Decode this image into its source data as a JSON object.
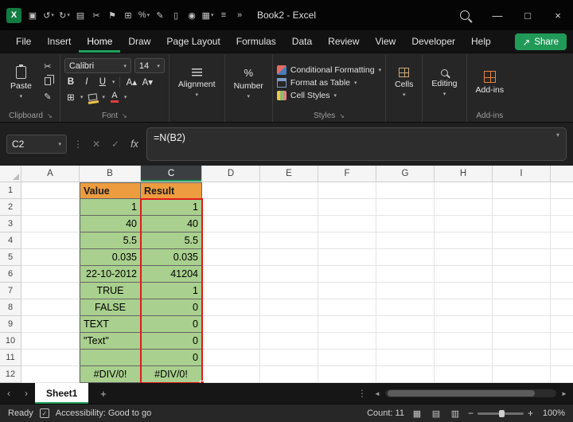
{
  "title_bar": {
    "title": "Book2 - Excel",
    "qat": [
      {
        "name": "save-icon",
        "glyph": "▣"
      },
      {
        "name": "undo-icon",
        "glyph": "↺",
        "chev": true
      },
      {
        "name": "redo-icon",
        "glyph": "↻",
        "chev": true
      },
      {
        "name": "copy-icon",
        "glyph": "▤"
      },
      {
        "name": "cut-icon",
        "glyph": "✂"
      },
      {
        "name": "flag-icon",
        "glyph": "⚑"
      },
      {
        "name": "borders-icon",
        "glyph": "⊞"
      },
      {
        "name": "percent-style-icon",
        "glyph": "%",
        "chev": true
      },
      {
        "name": "format-painter-icon",
        "glyph": "✎"
      },
      {
        "name": "new-document-icon",
        "glyph": "▯"
      },
      {
        "name": "camera-icon",
        "glyph": "◉"
      },
      {
        "name": "table-icon",
        "glyph": "▦",
        "chev": true
      },
      {
        "name": "sort-icon",
        "glyph": "≡"
      },
      {
        "name": "more-commands-icon",
        "glyph": "»"
      }
    ]
  },
  "menu": {
    "tabs": [
      "File",
      "Insert",
      "Home",
      "Draw",
      "Page Layout",
      "Formulas",
      "Data",
      "Review",
      "View",
      "Developer",
      "Help"
    ],
    "active_tab": "Home",
    "share_label": "Share"
  },
  "ribbon": {
    "paste_label": "Paste",
    "clipboard_group": "Clipboard",
    "font_name": "Calibri",
    "font_size": "14",
    "bold": "B",
    "italic": "I",
    "underline": "U",
    "font_group": "Font",
    "alignment_label": "Alignment",
    "number_label": "Number",
    "conditional_formatting": "Conditional Formatting",
    "format_as_table": "Format as Table",
    "cell_styles": "Cell Styles",
    "styles_group": "Styles",
    "cells_label": "Cells",
    "editing_label": "Editing",
    "addins_label": "Add-ins",
    "addins_group": "Add-ins"
  },
  "formula_bar": {
    "name_box_value": "C2",
    "fx_label": "fx",
    "formula": "=N(B2)"
  },
  "grid": {
    "column_headers": [
      "A",
      "B",
      "C",
      "D",
      "E",
      "F",
      "G",
      "H",
      "I"
    ],
    "selected_column": "C",
    "highlighted_range": "C2:C12",
    "rows": [
      {
        "n": "1",
        "b": "Value",
        "c": "Result",
        "type": "header",
        "b_align": "l",
        "c_align": "l"
      },
      {
        "n": "2",
        "b": "1",
        "c": "1",
        "b_align": "r",
        "c_align": "r"
      },
      {
        "n": "3",
        "b": "40",
        "c": "40",
        "b_align": "r",
        "c_align": "r"
      },
      {
        "n": "4",
        "b": "5.5",
        "c": "5.5",
        "b_align": "r",
        "c_align": "r"
      },
      {
        "n": "5",
        "b": "0.035",
        "c": "0.035",
        "b_align": "r",
        "c_align": "r"
      },
      {
        "n": "6",
        "b": "22-10-2012",
        "c": "41204",
        "b_align": "r",
        "c_align": "r"
      },
      {
        "n": "7",
        "b": "TRUE",
        "c": "1",
        "b_align": "c",
        "c_align": "r"
      },
      {
        "n": "8",
        "b": "FALSE",
        "c": "0",
        "b_align": "c",
        "c_align": "r"
      },
      {
        "n": "9",
        "b": "TEXT",
        "c": "0",
        "b_align": "l",
        "c_align": "r"
      },
      {
        "n": "10",
        "b": "\"Text\"",
        "c": "0",
        "b_align": "l",
        "c_align": "r"
      },
      {
        "n": "11",
        "b": "",
        "c": "0",
        "b_align": "l",
        "c_align": "r"
      },
      {
        "n": "12",
        "b": "#DIV/0!",
        "c": "#DIV/0!",
        "b_align": "c",
        "c_align": "c"
      }
    ]
  },
  "sheet_bar": {
    "active_sheet": "Sheet1"
  },
  "status_bar": {
    "ready": "Ready",
    "accessibility": "Accessibility: Good to go",
    "count": "Count: 11",
    "zoom": "100%"
  },
  "colors": {
    "header_fill": "#ED9C3F",
    "data_fill": "#A9D08E",
    "range_border": "#E01B1B",
    "accent_green": "#1EA35B"
  },
  "glyphs": {
    "excel_logo": "X",
    "chevron_down": "▾",
    "launcher": "↘",
    "cut": "✂",
    "format_painter": "✎",
    "dots_vertical": "⋮",
    "cancel": "✕",
    "check": "✓",
    "share": "↗",
    "minimize": "—",
    "maximize": "□",
    "close": "×",
    "nav_left": "‹",
    "nav_right": "›",
    "scroll_left": "◄",
    "scroll_right": "►",
    "minus": "−",
    "plus": "+",
    "borders": "⊞",
    "letter_a": "A",
    "grow_font": "A▴",
    "shrink_font": "A▾",
    "percent": "%",
    "view_normal": "▦",
    "view_layout": "▤",
    "view_break": "▥",
    "add_sheet": "+"
  }
}
